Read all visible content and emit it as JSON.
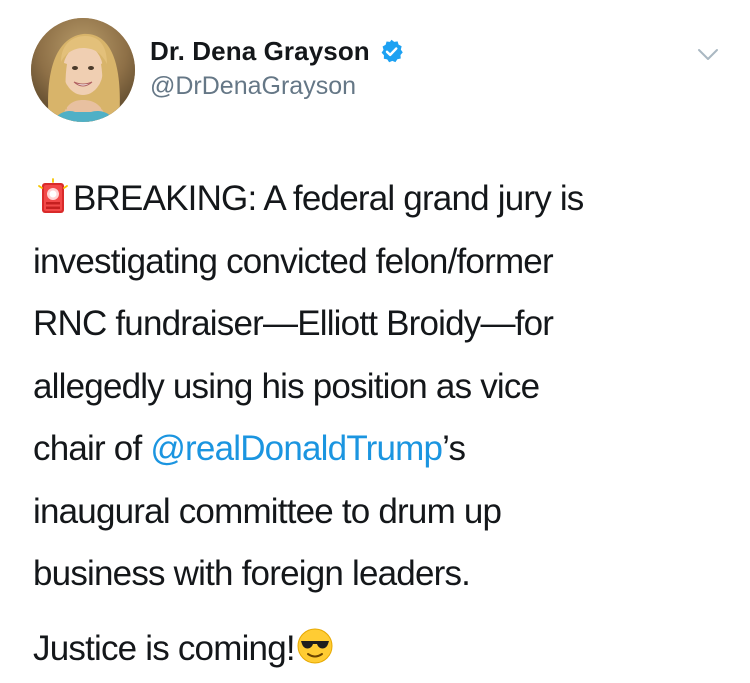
{
  "author": {
    "display_name": "Dr. Dena Grayson",
    "handle": "@DrDenaGrayson",
    "verified": true,
    "verified_icon": "verified-badge-icon",
    "avatar": "profile-photo"
  },
  "menu": {
    "icon": "chevron-down-icon"
  },
  "tweet": {
    "emoji_lead": "police-light-emoji",
    "line1_text": "BREAKING: A federal grand jury is",
    "line2_text": "investigating convicted felon/former",
    "line3_text": "RNC fundraiser—Elliott Broidy—for",
    "line4_text": "allegedly using his position as vice",
    "line5_pre": "chair of ",
    "mention": "@realDonaldTrump",
    "line5_post": "’s",
    "line6_text": "inaugural committee to drum up",
    "line7_text": "business with foreign leaders.",
    "closing_text": "Justice is coming!",
    "emoji_trail": "sunglasses-face-emoji"
  },
  "colors": {
    "text": "#14171a",
    "secondary": "#657786",
    "link": "#1b95e0",
    "verified": "#1da1f2"
  }
}
